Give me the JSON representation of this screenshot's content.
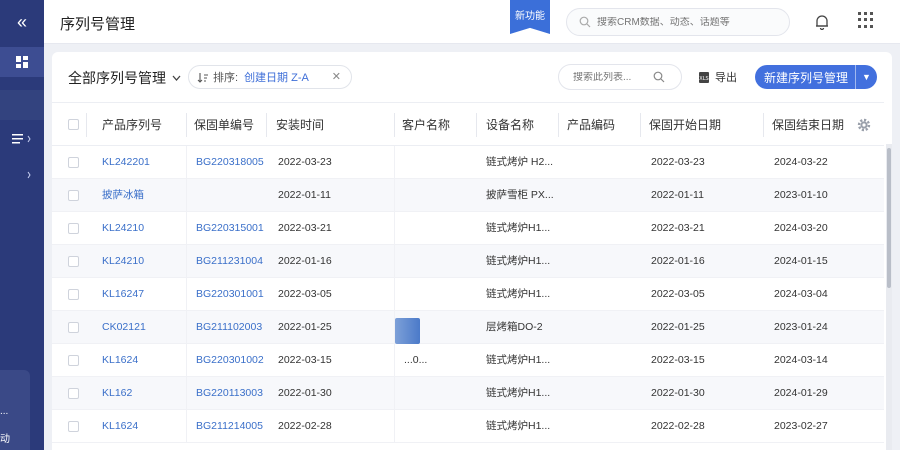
{
  "header": {
    "title": "序列号管理",
    "new_feature_badge": "新功能",
    "search_placeholder": "搜索CRM数据、动态、话题等"
  },
  "sidebar": {
    "bottom_fragments": [
      "...",
      "动"
    ]
  },
  "toolbar": {
    "view_name": "全部序列号管理",
    "sort_label": "排序:",
    "sort_value": "创建日期 Z-A",
    "list_search_placeholder": "搜索此列表...",
    "export_label": "导出",
    "new_button_label": "新建序列号管理"
  },
  "table": {
    "columns": [
      "产品序列号",
      "保固单编号",
      "安装时间",
      "客户名称",
      "设备名称",
      "产品编码",
      "保固开始日期",
      "保固结束日期"
    ],
    "rows": [
      {
        "serial": "KL242201",
        "warranty_no": "BG220318005",
        "install": "2022-03-23",
        "customer": "",
        "device": "链式烤炉 H2...",
        "code": "",
        "start": "2022-03-23",
        "end": "2024-03-22"
      },
      {
        "serial": "披萨冰箱",
        "warranty_no": "",
        "install": "2022-01-11",
        "customer": "",
        "device": "披萨雪柜 PX...",
        "code": "",
        "start": "2022-01-11",
        "end": "2023-01-10"
      },
      {
        "serial": "KL24210",
        "warranty_no": "BG220315001",
        "install": "2022-03-21",
        "customer": "",
        "device": "链式烤炉H1...",
        "code": "",
        "start": "2022-03-21",
        "end": "2024-03-20"
      },
      {
        "serial": "KL24210",
        "warranty_no": "BG211231004",
        "install": "2022-01-16",
        "customer": "",
        "device": "链式烤炉H1...",
        "code": "",
        "start": "2022-01-16",
        "end": "2024-01-15"
      },
      {
        "serial": "KL16247",
        "warranty_no": "BG220301001",
        "install": "2022-03-05",
        "customer": "",
        "device": "链式烤炉H1...",
        "code": "",
        "start": "2022-03-05",
        "end": "2024-03-04"
      },
      {
        "serial": "CK02121",
        "warranty_no": "BG211102003",
        "install": "2022-01-25",
        "customer": "",
        "device": "层烤箱DO-2",
        "code": "",
        "start": "2022-01-25",
        "end": "2023-01-24"
      },
      {
        "serial": "KL1624",
        "warranty_no": "BG220301002",
        "install": "2022-03-15",
        "customer": "...0...",
        "device": "链式烤炉H1...",
        "code": "",
        "start": "2022-03-15",
        "end": "2024-03-14"
      },
      {
        "serial": "KL162",
        "warranty_no": "BG220113003",
        "install": "2022-01-30",
        "customer": "",
        "device": "链式烤炉H1...",
        "code": "",
        "start": "2022-01-30",
        "end": "2024-01-29"
      },
      {
        "serial": "KL1624",
        "warranty_no": "BG211214005",
        "install": "2022-02-28",
        "customer": "",
        "device": "链式烤炉H1...",
        "code": "",
        "start": "2022-02-28",
        "end": "2023-02-27"
      }
    ]
  }
}
